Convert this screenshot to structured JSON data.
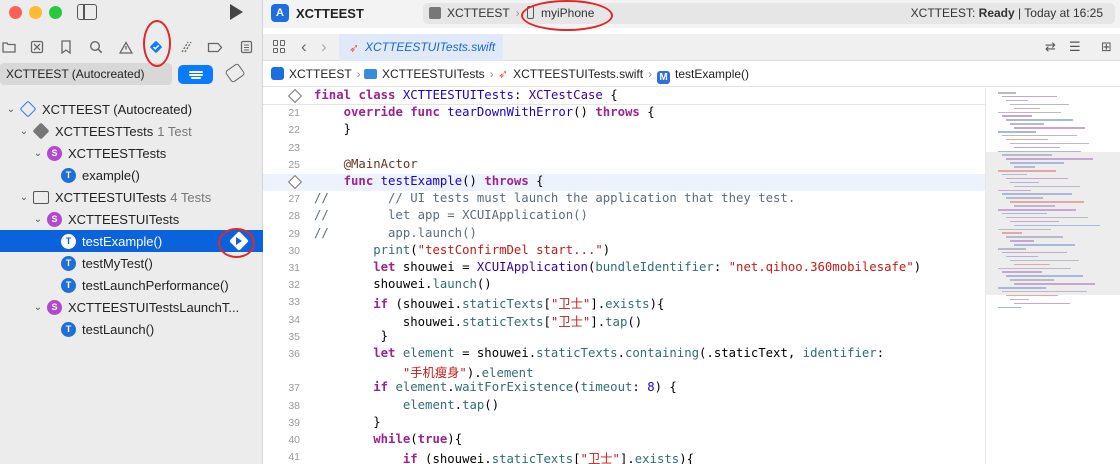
{
  "window": {
    "project_name": "XCTTEEST"
  },
  "activity": {
    "scheme": "XCTTEEST",
    "destination": "myiPhone",
    "status_prefix": "XCTTEEST: ",
    "status_state": "Ready",
    "status_suffix": " | Today at 16:25"
  },
  "navigator": {
    "tabs": [
      "folder-icon",
      "x-square-icon",
      "bookmark-icon",
      "search-icon",
      "warning-icon",
      "test-icon",
      "debug-icon",
      "breakpoint-icon",
      "report-icon"
    ],
    "scheme_filter": "XCTTEEST (Autocreated)",
    "tree": [
      {
        "label": "XCTTEEST (Autocreated)",
        "count": "",
        "indent": 0,
        "chevron": "v",
        "icon": "plan"
      },
      {
        "label": "XCTTEESTTests",
        "count": "1 Test",
        "indent": 1,
        "chevron": "v",
        "icon": "bundle"
      },
      {
        "label": "XCTTEESTTests",
        "count": "",
        "indent": 2,
        "chevron": "v",
        "icon": "S"
      },
      {
        "label": "example()",
        "count": "",
        "indent": 3,
        "chevron": "",
        "icon": "T"
      },
      {
        "label": "XCTTEESTUITests",
        "count": "4 Tests",
        "indent": 1,
        "chevron": "v",
        "icon": "ui"
      },
      {
        "label": "XCTTEESTUITests",
        "count": "",
        "indent": 2,
        "chevron": "v",
        "icon": "S"
      },
      {
        "label": "testExample()",
        "count": "",
        "indent": 3,
        "chevron": "",
        "icon": "T",
        "selected": true
      },
      {
        "label": "testMyTest()",
        "count": "",
        "indent": 3,
        "chevron": "",
        "icon": "T"
      },
      {
        "label": "testLaunchPerformance()",
        "count": "",
        "indent": 3,
        "chevron": "",
        "icon": "T"
      },
      {
        "label": "XCTTEESTUITestsLaunchT...",
        "count": "",
        "indent": 2,
        "chevron": "v",
        "icon": "S"
      },
      {
        "label": "testLaunch()",
        "count": "",
        "indent": 3,
        "chevron": "",
        "icon": "T"
      }
    ]
  },
  "tab": {
    "file": "XCTTEESTUITests.swift"
  },
  "jumpbar": {
    "project": "XCTTEEST",
    "group": "XCTTEESTUITests",
    "file": "XCTTEESTUITests.swift",
    "symbol": "testExample()"
  },
  "editor": {
    "sticky_header": "final class XCTTEESTUITests: XCTestCase {",
    "lines": [
      {
        "n": "21",
        "text": "    override func tearDownWithError() throws {"
      },
      {
        "n": "22",
        "text": "    }"
      },
      {
        "n": "23",
        "text": ""
      },
      {
        "n": "25",
        "text": "    @MainActor"
      },
      {
        "n": "",
        "text": "    func testExample() throws {",
        "diamond": true
      },
      {
        "n": "27",
        "text": "//        // UI tests must launch the application that they test."
      },
      {
        "n": "28",
        "text": "//        let app = XCUIApplication()"
      },
      {
        "n": "29",
        "text": "//        app.launch()"
      },
      {
        "n": "30",
        "text": "        print(\"testConfirmDel start...\")"
      },
      {
        "n": "31",
        "text": "        let shouwei = XCUIApplication(bundleIdentifier: \"net.qihoo.360mobilesafe\")"
      },
      {
        "n": "32",
        "text": "        shouwei.launch()"
      },
      {
        "n": "33",
        "text": "        if (shouwei.staticTexts[\"卫士\"].exists){"
      },
      {
        "n": "34",
        "text": "            shouwei.staticTexts[\"卫士\"].tap()"
      },
      {
        "n": "35",
        "text": "         }"
      },
      {
        "n": "36",
        "text": "        let element = shouwei.staticTexts.containing(.staticText, identifier:"
      },
      {
        "n": "",
        "text": "            \"手机瘦身\").element"
      },
      {
        "n": "37",
        "text": "        if element.waitForExistence(timeout: 8) {"
      },
      {
        "n": "38",
        "text": "            element.tap()"
      },
      {
        "n": "39",
        "text": "        }"
      },
      {
        "n": "40",
        "text": "        while(true){"
      },
      {
        "n": "41",
        "text": "            if (shouwei.staticTexts[\"卫士\"].exists){"
      }
    ]
  },
  "colors": {
    "accent": "#0a63dd",
    "annotation": "#e3262a",
    "test_icon": "#1f6fd7",
    "suite_icon": "#b248cf"
  }
}
